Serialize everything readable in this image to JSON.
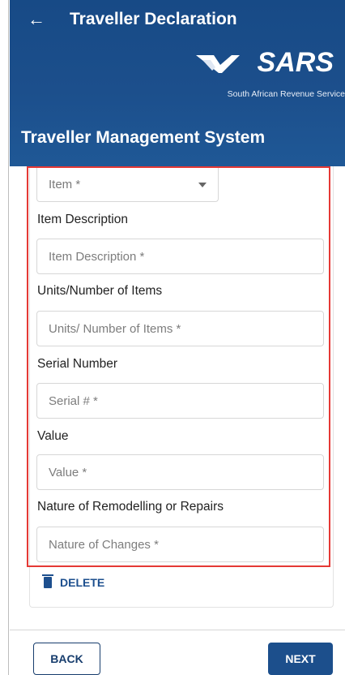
{
  "header": {
    "back_icon": "left-arrow-icon",
    "title": "Traveller Declaration",
    "brand": "SARS",
    "brand_sub": "South African Revenue Service",
    "system_title": "Traveller Management System"
  },
  "form": {
    "item_select": "Item *",
    "labels": {
      "item_description": "Item Description",
      "units": "Units/Number of Items",
      "serial": "Serial Number",
      "value": "Value",
      "nature": "Nature of Remodelling or Repairs"
    },
    "placeholders": {
      "item_description": "Item Description *",
      "units": "Units/ Number of Items *",
      "serial": "Serial # *",
      "value": "Value *",
      "nature": "Nature of Changes *"
    },
    "delete_label": "DELETE",
    "delete_icon": "trash-icon"
  },
  "footer": {
    "back_label": "BACK",
    "next_label": "NEXT"
  },
  "colors": {
    "brand_blue": "#1c4f8c",
    "highlight_red": "#e53935"
  }
}
